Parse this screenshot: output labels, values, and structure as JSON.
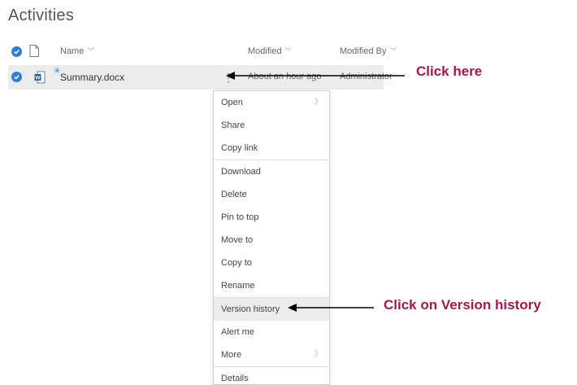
{
  "page": {
    "title": "Activities"
  },
  "header": {
    "name_label": "Name",
    "modified_label": "Modified",
    "modified_by_label": "Modified By"
  },
  "file": {
    "name": "Summary.docx",
    "modified": "About an hour ago",
    "modified_by": "Administrator",
    "more_icon": "more-vertical-icon"
  },
  "menu": {
    "items": [
      {
        "label": "Open",
        "has_submenu": true
      },
      {
        "label": "Share"
      },
      {
        "label": "Copy link"
      },
      {
        "label": "Download"
      },
      {
        "label": "Delete"
      },
      {
        "label": "Pin to top"
      },
      {
        "label": "Move to"
      },
      {
        "label": "Copy to"
      },
      {
        "label": "Rename"
      },
      {
        "label": "Version history",
        "highlighted": true
      },
      {
        "label": "Alert me"
      },
      {
        "label": "More",
        "has_submenu": true
      },
      {
        "label": "Details"
      }
    ]
  },
  "annotations": {
    "click_here": "Click here",
    "click_version_history": "Click on Version history",
    "color": "#a01b46"
  },
  "colors": {
    "accent": "#2f7fd1",
    "row_highlight": "#ececec"
  }
}
